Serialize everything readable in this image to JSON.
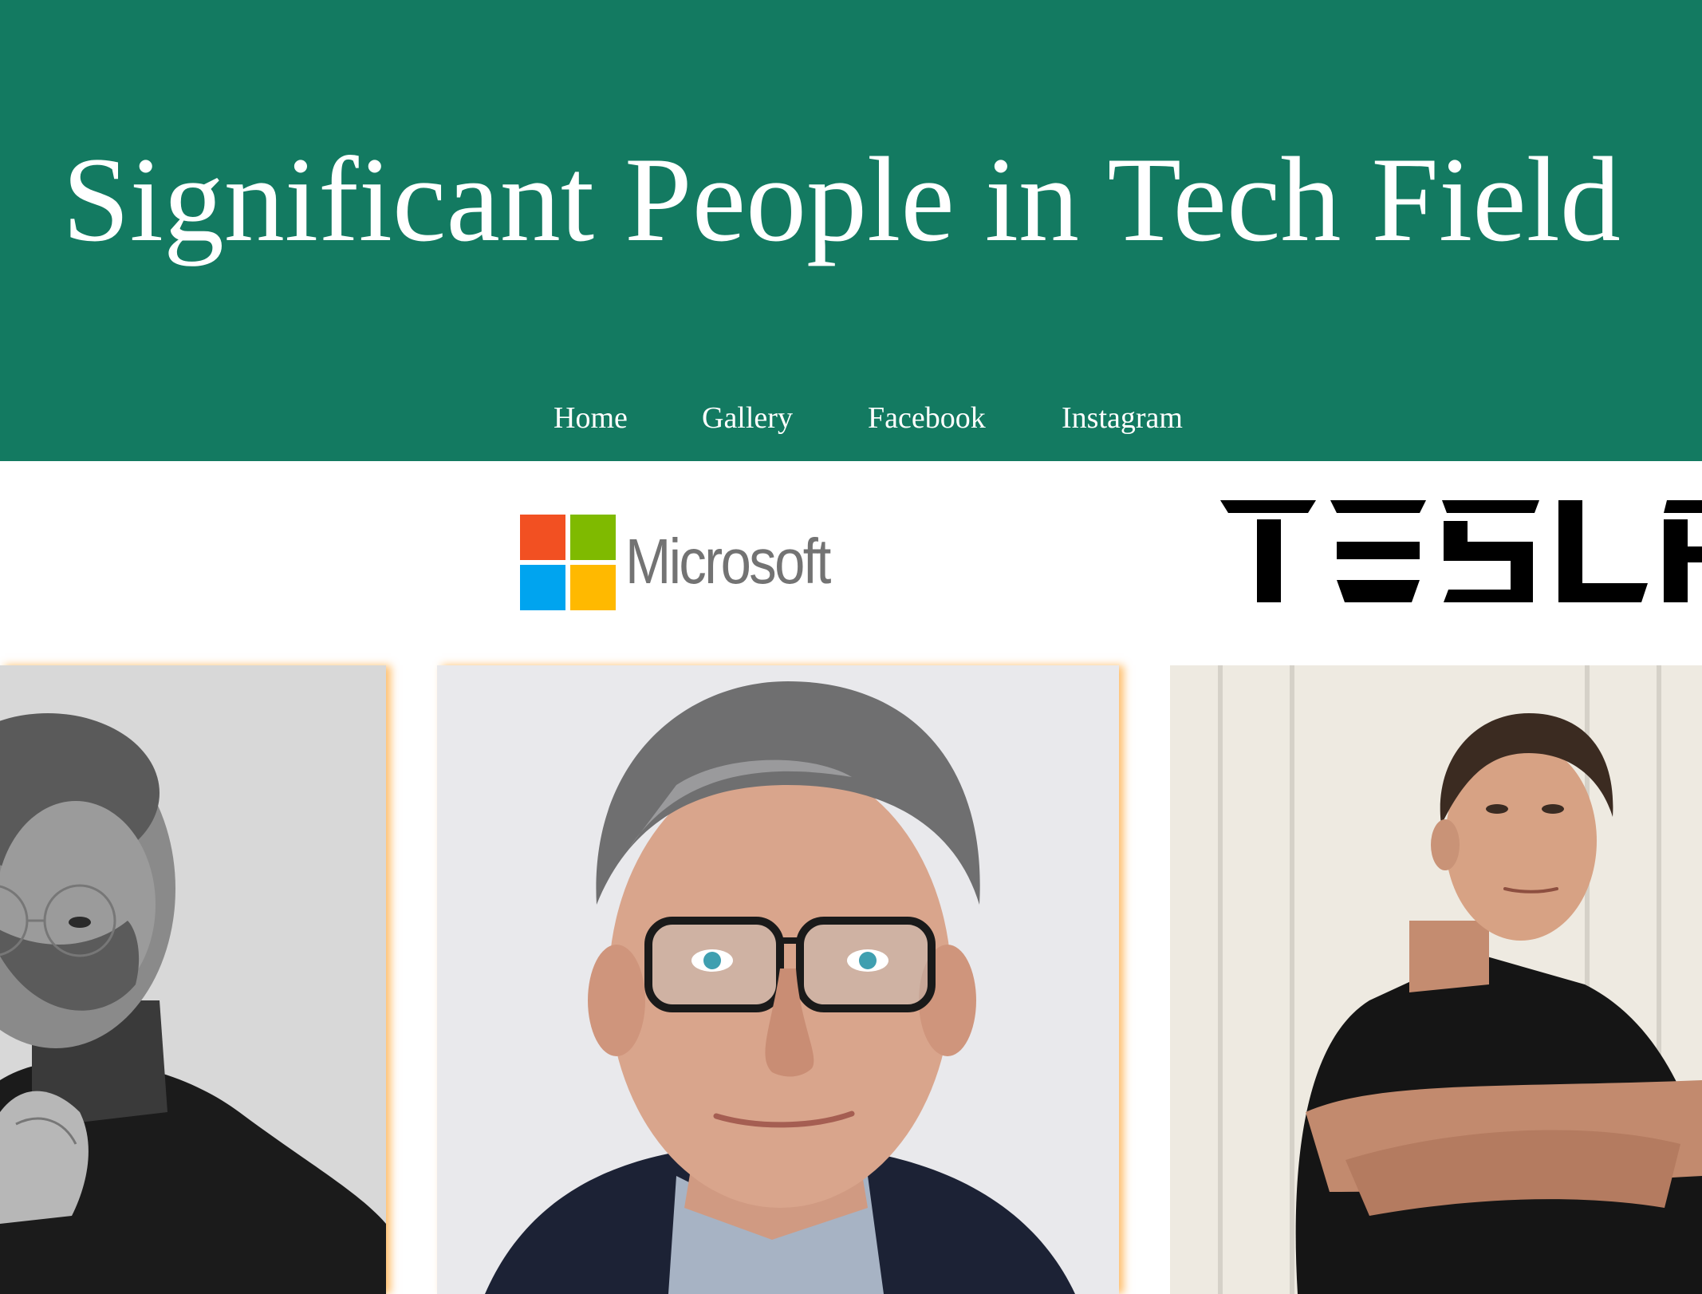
{
  "header": {
    "title": "Significant People in Tech Field",
    "background_color": "#137a61"
  },
  "nav": {
    "items": [
      {
        "label": "Home"
      },
      {
        "label": "Gallery"
      },
      {
        "label": "Facebook"
      },
      {
        "label": "Instagram"
      }
    ]
  },
  "logos": {
    "microsoft": {
      "text": "Microsoft",
      "colors": [
        "#f25022",
        "#7fba00",
        "#00a4ef",
        "#ffb900"
      ]
    },
    "tesla": {
      "text": "TESLA"
    }
  },
  "gallery": {
    "photos": [
      {
        "name": "Steve Jobs portrait",
        "style": "black-and-white"
      },
      {
        "name": "Bill Gates portrait",
        "style": "color"
      },
      {
        "name": "Elon Musk portrait",
        "style": "color"
      }
    ],
    "accent_shadow_color": "#ffaa3c"
  }
}
